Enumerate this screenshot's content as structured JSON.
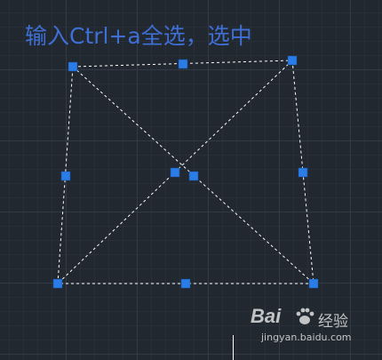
{
  "instruction_text": "输入Ctrl+a全选，选中",
  "colors": {
    "background": "#212830",
    "instruction_text": "#3f6fd4",
    "grip": "#2a7ce6",
    "selection_edge": "#ffffff"
  },
  "watermark": {
    "logo_text": "Bai",
    "brand_text": "经验",
    "url_text": "jingyan.baidu.com",
    "icon": "paw-icon"
  }
}
